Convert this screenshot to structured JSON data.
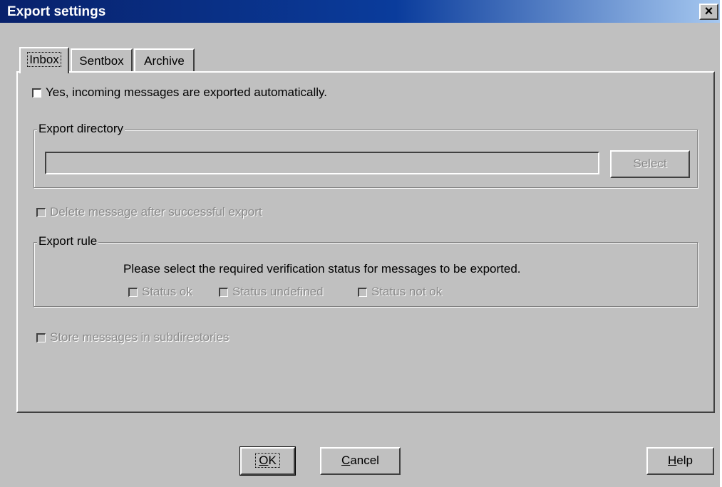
{
  "window": {
    "title": "Export settings",
    "close_label": "×"
  },
  "tabs": [
    {
      "label": "Inbox",
      "active": true
    },
    {
      "label": "Sentbox",
      "active": false
    },
    {
      "label": "Archive",
      "active": false
    }
  ],
  "inbox": {
    "auto_export_label": "Yes, incoming messages are exported automatically.",
    "export_directory": {
      "group_label": "Export directory",
      "path_value": "",
      "select_label": "Select"
    },
    "delete_after_export_label": "Delete message after successful export",
    "export_rule": {
      "group_label": "Export rule",
      "description": "Please select the required verification status for messages to be exported.",
      "status_ok_label": "Status ok",
      "status_undefined_label": "Status undefined",
      "status_not_ok_label": "Status not ok"
    },
    "subdirectories_label": "Store messages in subdirectories"
  },
  "buttons": {
    "ok": {
      "mnemonic": "O",
      "rest": "K"
    },
    "cancel": {
      "mnemonic": "C",
      "rest": "ancel"
    },
    "help": {
      "mnemonic": "H",
      "rest": "elp"
    }
  }
}
